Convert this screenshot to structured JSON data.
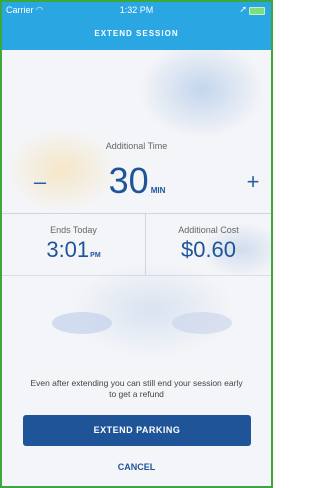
{
  "status_bar": {
    "carrier": "Carrier",
    "time": "1:32 PM"
  },
  "nav": {
    "title": "EXTEND SESSION"
  },
  "additional_time": {
    "label": "Additional Time",
    "value": "30",
    "unit": "MIN",
    "decrement_symbol": "–",
    "increment_symbol": "+"
  },
  "ends": {
    "label": "Ends Today",
    "time": "3:01",
    "period": "PM"
  },
  "cost": {
    "label": "Additional Cost",
    "value": "$0.60"
  },
  "info_text": "Even after extending you can still end your session early to get a refund",
  "actions": {
    "extend_label": "EXTEND PARKING",
    "cancel_label": "CANCEL"
  },
  "colors": {
    "header": "#2aa7e3",
    "accent": "#1f5499"
  }
}
